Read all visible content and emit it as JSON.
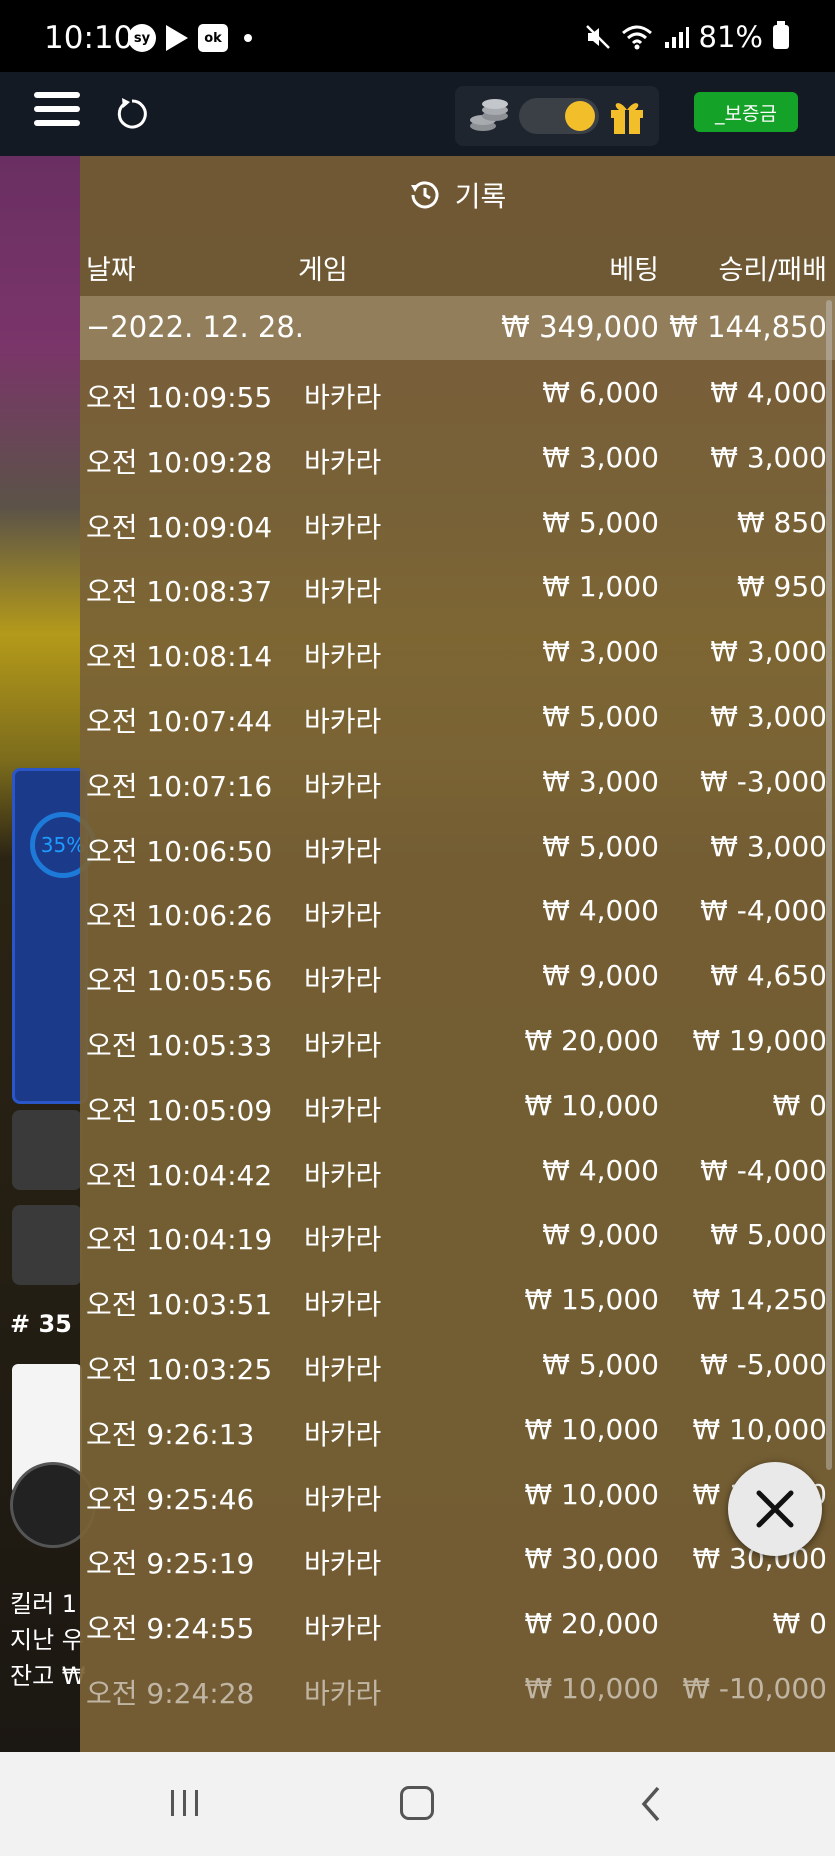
{
  "status_bar": {
    "time": "10:10",
    "badge_sy": "sy",
    "badge_ok": "ok",
    "battery": "81%",
    "icons": [
      "sy-icon",
      "play-store-icon",
      "ok-icon",
      "dot-icon",
      "mute-icon",
      "wifi-icon",
      "signal-icon",
      "battery-icon"
    ]
  },
  "header": {
    "deposit_label": "_보증금",
    "toggle_on": true,
    "colors": {
      "header_bg": "#141a23",
      "deposit_green": "#14a228",
      "toggle_knob": "#f2bf2b"
    }
  },
  "background": {
    "percent": "35%",
    "round": "# 35",
    "text1": "킬러 1",
    "text2": "지난 우",
    "text3": "잔고 ₩"
  },
  "history": {
    "title": "기록",
    "columns": {
      "date": "날짜",
      "game": "게임",
      "bet": "베팅",
      "win_loss": "승리/패배"
    },
    "summary": {
      "date": "−2022. 12. 28.",
      "bet": "₩ 349,000",
      "win_loss": "₩ 144,850"
    },
    "rows": [
      {
        "time": "오전 10:09:55",
        "game": "바카라",
        "bet": "₩ 6,000",
        "win_loss": "₩ 4,000"
      },
      {
        "time": "오전 10:09:28",
        "game": "바카라",
        "bet": "₩ 3,000",
        "win_loss": "₩ 3,000"
      },
      {
        "time": "오전 10:09:04",
        "game": "바카라",
        "bet": "₩ 5,000",
        "win_loss": "₩ 850"
      },
      {
        "time": "오전 10:08:37",
        "game": "바카라",
        "bet": "₩ 1,000",
        "win_loss": "₩ 950"
      },
      {
        "time": "오전 10:08:14",
        "game": "바카라",
        "bet": "₩ 3,000",
        "win_loss": "₩ 3,000"
      },
      {
        "time": "오전 10:07:44",
        "game": "바카라",
        "bet": "₩ 5,000",
        "win_loss": "₩ 3,000"
      },
      {
        "time": "오전 10:07:16",
        "game": "바카라",
        "bet": "₩ 3,000",
        "win_loss": "₩ -3,000"
      },
      {
        "time": "오전 10:06:50",
        "game": "바카라",
        "bet": "₩ 5,000",
        "win_loss": "₩ 3,000"
      },
      {
        "time": "오전 10:06:26",
        "game": "바카라",
        "bet": "₩ 4,000",
        "win_loss": "₩ -4,000"
      },
      {
        "time": "오전 10:05:56",
        "game": "바카라",
        "bet": "₩ 9,000",
        "win_loss": "₩ 4,650"
      },
      {
        "time": "오전 10:05:33",
        "game": "바카라",
        "bet": "₩ 20,000",
        "win_loss": "₩ 19,000"
      },
      {
        "time": "오전 10:05:09",
        "game": "바카라",
        "bet": "₩ 10,000",
        "win_loss": "₩ 0"
      },
      {
        "time": "오전 10:04:42",
        "game": "바카라",
        "bet": "₩ 4,000",
        "win_loss": "₩ -4,000"
      },
      {
        "time": "오전 10:04:19",
        "game": "바카라",
        "bet": "₩ 9,000",
        "win_loss": "₩ 5,000"
      },
      {
        "time": "오전 10:03:51",
        "game": "바카라",
        "bet": "₩ 15,000",
        "win_loss": "₩ 14,250"
      },
      {
        "time": "오전 10:03:25",
        "game": "바카라",
        "bet": "₩ 5,000",
        "win_loss": "₩ -5,000"
      },
      {
        "time": "오전 9:26:13",
        "game": "바카라",
        "bet": "₩ 10,000",
        "win_loss": "₩ 10,000"
      },
      {
        "time": "오전 9:25:46",
        "game": "바카라",
        "bet": "₩ 10,000",
        "win_loss": "₩ 10,000"
      },
      {
        "time": "오전 9:25:19",
        "game": "바카라",
        "bet": "₩ 30,000",
        "win_loss": "₩ 30,000"
      },
      {
        "time": "오전 9:24:55",
        "game": "바카라",
        "bet": "₩ 20,000",
        "win_loss": "₩ 0"
      },
      {
        "time": "오전 9:24:28",
        "game": "바카라",
        "bet": "₩ 10,000",
        "win_loss": "₩ -10,000"
      }
    ]
  },
  "nav": {
    "icons": [
      "recents-icon",
      "home-icon",
      "back-icon"
    ]
  }
}
